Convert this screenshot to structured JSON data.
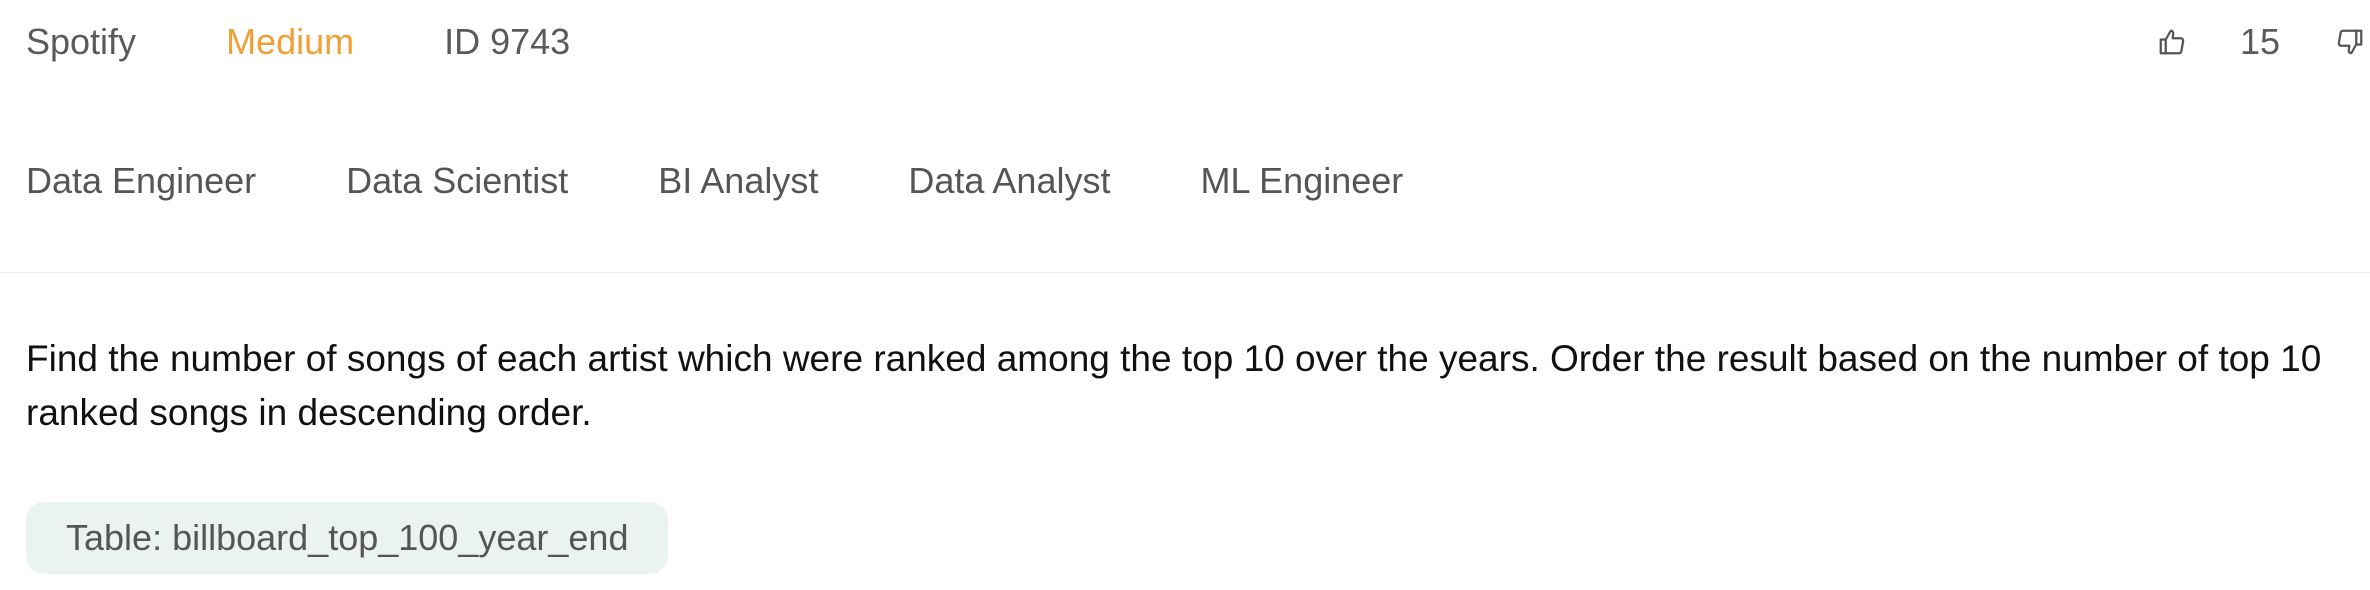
{
  "header": {
    "company": "Spotify",
    "difficulty": "Medium",
    "id_label": "ID 9743",
    "vote_count": "15",
    "icons": {
      "upvote": "thumbs-up-icon",
      "downvote": "thumbs-down-icon"
    },
    "colors": {
      "difficulty": "#f0a035"
    }
  },
  "roles": [
    "Data Engineer",
    "Data Scientist",
    "BI Analyst",
    "Data Analyst",
    "ML Engineer"
  ],
  "question": {
    "text": "Find the number of songs of each artist which were ranked among the top 10 over the years. Order the result based on the number of top 10 ranked songs in descending order."
  },
  "table": {
    "label": "Table:",
    "name": "billboard_top_100_year_end"
  }
}
